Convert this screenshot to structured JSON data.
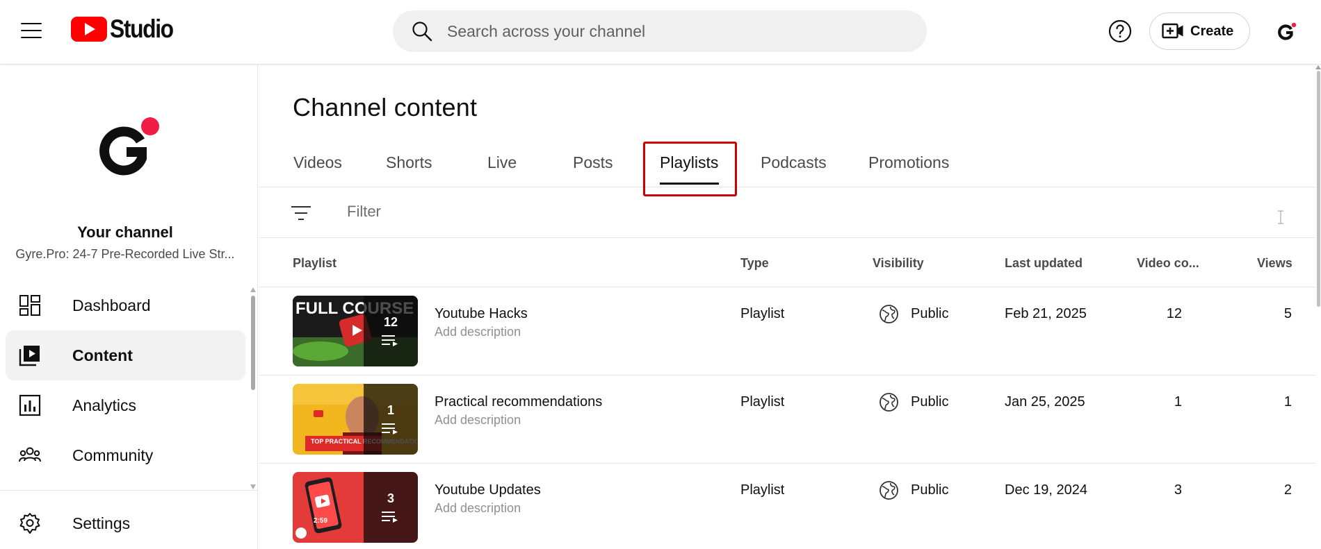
{
  "header": {
    "app_name": "Studio",
    "search_placeholder": "Search across your channel",
    "create_label": "Create"
  },
  "sidebar": {
    "your_channel": "Your channel",
    "channel_name": "Gyre.Pro: 24-7 Pre-Recorded Live Str...",
    "items": [
      {
        "label": "Dashboard",
        "icon": "dashboard-icon"
      },
      {
        "label": "Content",
        "icon": "content-icon",
        "active": true
      },
      {
        "label": "Analytics",
        "icon": "analytics-icon"
      },
      {
        "label": "Community",
        "icon": "community-icon"
      }
    ],
    "settings_label": "Settings"
  },
  "main": {
    "title": "Channel content",
    "tabs": [
      {
        "label": "Videos"
      },
      {
        "label": "Shorts"
      },
      {
        "label": "Live"
      },
      {
        "label": "Posts"
      },
      {
        "label": "Playlists",
        "active": true
      },
      {
        "label": "Podcasts"
      },
      {
        "label": "Promotions"
      }
    ],
    "filter_placeholder": "Filter",
    "columns": {
      "playlist": "Playlist",
      "type": "Type",
      "visibility": "Visibility",
      "last_updated": "Last updated",
      "video_count": "Video co...",
      "views": "Views"
    },
    "rows": [
      {
        "title": "Youtube Hacks",
        "description": "Add description",
        "type": "Playlist",
        "visibility": "Public",
        "last_updated": "Feb 21, 2025",
        "video_count": "12",
        "views": "5",
        "thumb_count": "12",
        "thumb_text": "FULL COURSE"
      },
      {
        "title": "Practical recommendations",
        "description": "Add description",
        "type": "Playlist",
        "visibility": "Public",
        "last_updated": "Jan 25, 2025",
        "video_count": "1",
        "views": "1",
        "thumb_count": "1",
        "thumb_text": "TOP PRACTICAL RECOMMENDATIONS"
      },
      {
        "title": "Youtube Updates",
        "description": "Add description",
        "type": "Playlist",
        "visibility": "Public",
        "last_updated": "Dec 19, 2024",
        "video_count": "3",
        "views": "2",
        "thumb_count": "3",
        "thumb_text": "2:59"
      }
    ]
  },
  "colors": {
    "brand_red": "#ff0000",
    "accent_dot": "#f21d44",
    "highlight": "#cc0000"
  }
}
